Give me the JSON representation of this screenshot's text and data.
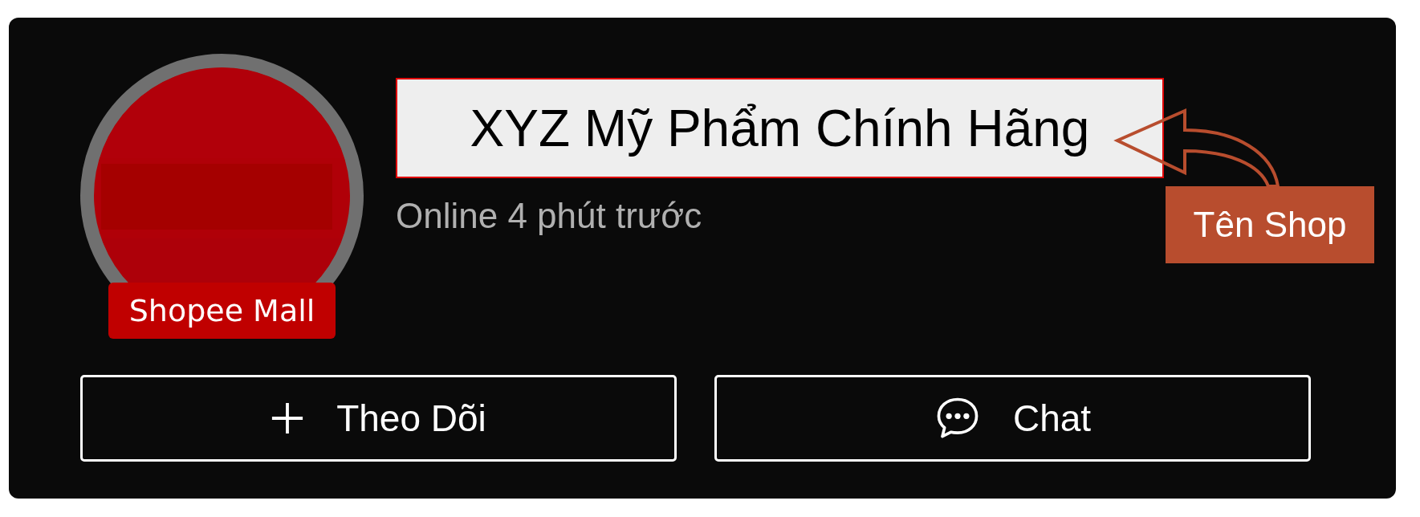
{
  "shop": {
    "name": "XYZ Mỹ Phẩm Chính Hãng",
    "status": "Online 4 phút trước",
    "badge": "Shopee Mall"
  },
  "callout": {
    "label": "Tên Shop"
  },
  "buttons": [
    {
      "kind": "follow",
      "label": "Theo Dõi"
    },
    {
      "kind": "chat",
      "label": "Chat"
    }
  ]
}
